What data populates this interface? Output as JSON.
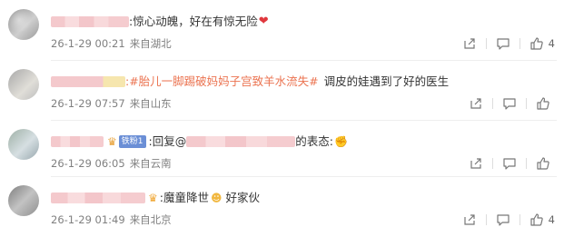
{
  "comments": [
    {
      "content": ":惊心动魄，好在有惊无险",
      "emoji": "❤",
      "time": "26-1-29 00:21",
      "location": "来自湖北",
      "likes": "4"
    },
    {
      "topic": ":#胎儿一脚踢破妈妈子宫致羊水流失#",
      "content": "调皮的娃遇到了好的医生",
      "time": "26-1-29 07:57",
      "location": "来自山东",
      "likes": ""
    },
    {
      "fan_badge": "铁粉1",
      "reply_prefix": ":回复@",
      "reply_suffix": "的表态:",
      "time": "26-1-29 06:05",
      "location": "来自云南",
      "likes": ""
    },
    {
      "content": ":魔童降世",
      "content2": "好家伙",
      "time": "26-1-29 01:49",
      "location": "来自北京",
      "likes": "4"
    }
  ],
  "icons": {
    "share": "share-icon",
    "comment": "comment-icon",
    "like": "thumbs-up-icon"
  }
}
